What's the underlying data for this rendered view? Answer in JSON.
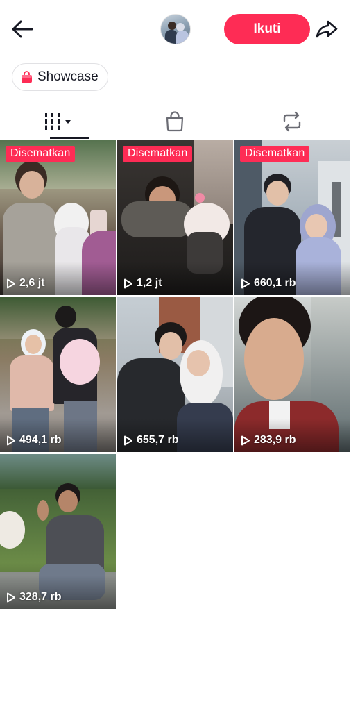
{
  "header": {
    "follow_label": "Ikuti"
  },
  "showcase": {
    "label": "Showcase"
  },
  "tabs": [
    {
      "name": "videos",
      "icon": "grid-bars-icon",
      "active": true
    },
    {
      "name": "shop",
      "icon": "shopping-bag-icon",
      "active": false
    },
    {
      "name": "reposts",
      "icon": "repost-icon",
      "active": false
    }
  ],
  "videos": [
    {
      "pinned_label": "Disematkan",
      "views": "2,6 jt"
    },
    {
      "pinned_label": "Disematkan",
      "views": "1,2 jt"
    },
    {
      "pinned_label": "Disematkan",
      "views": "660,1 rb"
    },
    {
      "pinned_label": "",
      "views": "494,1 rb"
    },
    {
      "pinned_label": "",
      "views": "655,7 rb"
    },
    {
      "pinned_label": "",
      "views": "283,9 rb"
    },
    {
      "pinned_label": "",
      "views": "328,7 rb"
    }
  ],
  "colors": {
    "accent": "#fe2c55",
    "text": "#161823",
    "background": "#ffffff"
  }
}
